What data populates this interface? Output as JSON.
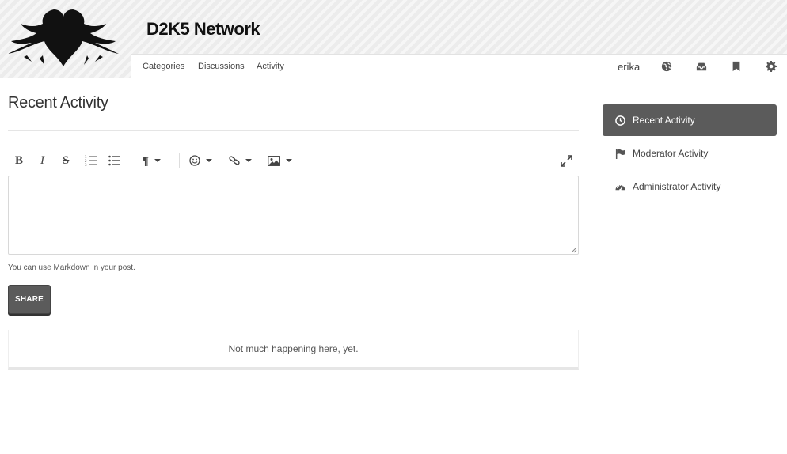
{
  "header": {
    "site_title": "D2K5 Network",
    "logo_icon": "winged-heart-logo"
  },
  "nav": {
    "links": [
      "Categories",
      "Discussions",
      "Activity"
    ],
    "username": "erika",
    "icons": [
      "globe-icon",
      "inbox-icon",
      "bookmark-icon",
      "gear-icon"
    ]
  },
  "main": {
    "page_title": "Recent Activity",
    "toolbar_icons": [
      "bold-icon",
      "italic-icon",
      "strikethrough-icon",
      "ordered-list-icon",
      "bullet-list-icon",
      "paragraph-icon",
      "emoji-icon",
      "link-icon",
      "image-icon",
      "fullscreen-icon"
    ],
    "toolbar_labels": {
      "bold": "B",
      "italic": "I",
      "strike": "S",
      "paragraph": "¶"
    },
    "editor_value": "",
    "markdown_hint": "You can use Markdown in your post.",
    "share_label": "SHARE",
    "empty_message": "Not much happening here, yet."
  },
  "sidebar": {
    "items": [
      {
        "label": "Recent Activity",
        "icon": "clock-icon",
        "active": true
      },
      {
        "label": "Moderator Activity",
        "icon": "flag-icon",
        "active": false
      },
      {
        "label": "Administrator Activity",
        "icon": "dashboard-icon",
        "active": false
      }
    ]
  },
  "colors": {
    "accent": "#5b5b5b",
    "banner": "#ececec"
  }
}
